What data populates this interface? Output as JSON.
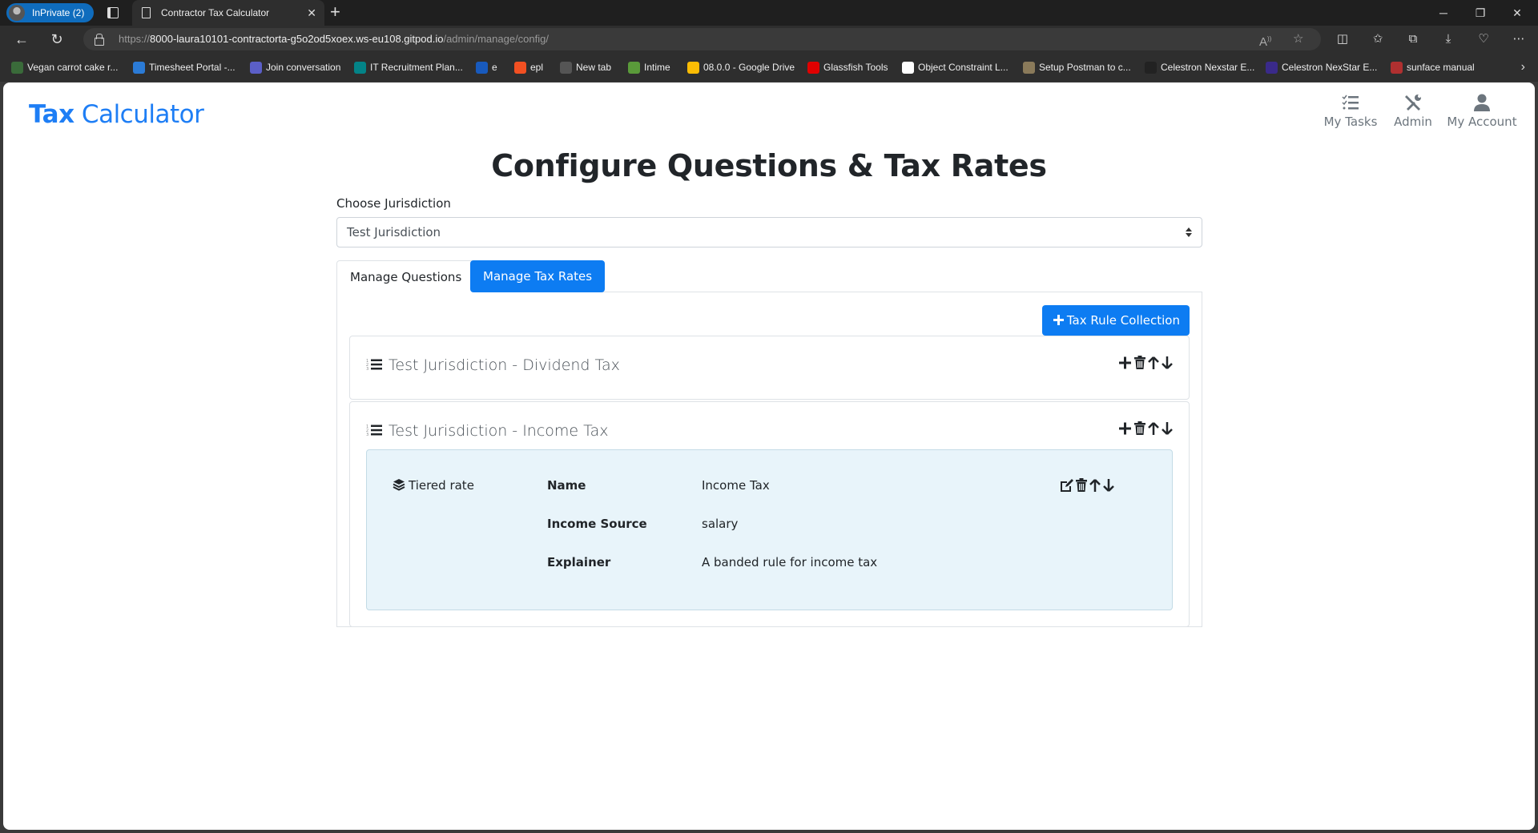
{
  "browser": {
    "profile_label": "InPrivate (2)",
    "tab_title": "Contractor Tax Calculator",
    "url_scheme": "https://",
    "url_host": "8000-laura10101-contractorta-g5o2od5xoex.ws-eu108.gitpod.io",
    "url_path": "/admin/manage/config/",
    "bookmarks": [
      {
        "label": "Vegan carrot cake r...",
        "icon": "gf-icon",
        "color": "#3a6b3a"
      },
      {
        "label": "Timesheet Portal -...",
        "icon": "timesheet-icon",
        "color": "#2b7bd6"
      },
      {
        "label": "Join conversation",
        "icon": "teams-icon",
        "color": "#5b5fc7"
      },
      {
        "label": "IT Recruitment Plan...",
        "icon": "sharepoint-icon",
        "color": "#038387"
      },
      {
        "label": "e",
        "icon": "word-icon",
        "color": "#185abd"
      },
      {
        "label": "epl",
        "icon": "microsoft-icon",
        "color": "#f25022"
      },
      {
        "label": "New tab",
        "icon": "newtab-icon",
        "color": "#555555"
      },
      {
        "label": "Intime",
        "icon": "intime-icon",
        "color": "#5a9a3a"
      },
      {
        "label": "08.0.0 - Google Drive",
        "icon": "google-drive-icon",
        "color": "#fbbc04"
      },
      {
        "label": "Glassfish Tools",
        "icon": "oracle-icon",
        "color": "#e00000"
      },
      {
        "label": "Object Constraint L...",
        "icon": "wikipedia-icon",
        "color": "#ffffff"
      },
      {
        "label": "Setup Postman to c...",
        "icon": "postman-thumb-icon",
        "color": "#8a7a5a"
      },
      {
        "label": "Celestron Nexstar E...",
        "icon": "telescope-icon",
        "color": "#222222"
      },
      {
        "label": "Celestron NexStar E...",
        "icon": "celestron-icon",
        "color": "#3a2a8a"
      },
      {
        "label": "sunface manual",
        "icon": "sunface-icon",
        "color": "#b03030"
      }
    ]
  },
  "app": {
    "brand_bold": "Tax",
    "brand_rest": " Calculator",
    "brand_color": "#1e7ef5",
    "nav": [
      {
        "label": "My Tasks",
        "icon": "tasks-icon"
      },
      {
        "label": "Admin",
        "icon": "tools-icon"
      },
      {
        "label": "My Account",
        "icon": "user-icon"
      }
    ]
  },
  "main": {
    "title": "Configure Questions & Tax Rates",
    "jurisdiction_label": "Choose Jurisdiction",
    "jurisdiction_selected": "Test Jurisdiction",
    "tabs": [
      {
        "label": "Manage Questions",
        "active": false
      },
      {
        "label": "Manage Tax Rates",
        "active": true
      }
    ],
    "add_collection_label": "Tax Rule Collection",
    "collections": [
      {
        "title": "Test Jurisdiction - Dividend Tax",
        "rules": []
      },
      {
        "title": "Test Jurisdiction - Income Tax",
        "rules": [
          {
            "type": "Tiered rate",
            "fields": [
              {
                "label": "Name",
                "value": "Income Tax"
              },
              {
                "label": "Income Source",
                "value": "salary"
              },
              {
                "label": "Explainer",
                "value": "A banded rule for income tax"
              }
            ]
          }
        ]
      }
    ],
    "accent_color": "#0d7cf2",
    "rule_bg_color": "#e8f4fa"
  }
}
